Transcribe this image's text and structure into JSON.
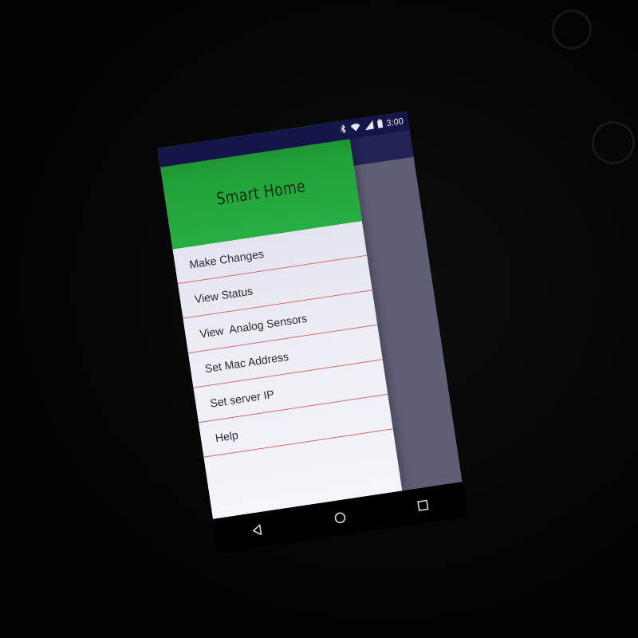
{
  "status_bar": {
    "time": "3:00",
    "icons": [
      "bluetooth-icon",
      "wifi-icon",
      "signal-icon",
      "battery-icon"
    ]
  },
  "drawer": {
    "header_color": "#22a33a",
    "title": "Smart Home",
    "divider_color": "#d46a6a",
    "items": [
      {
        "label": "Make Changes"
      },
      {
        "label": "View Status"
      },
      {
        "label": "View  Analog Sensors"
      },
      {
        "label": "Set Mac Address"
      },
      {
        "label": "Set server IP"
      },
      {
        "label": "Help"
      }
    ]
  },
  "app_toolbar_color": "#14164a",
  "nav_bar": {
    "buttons": [
      "back-icon",
      "home-icon",
      "recents-icon"
    ]
  }
}
